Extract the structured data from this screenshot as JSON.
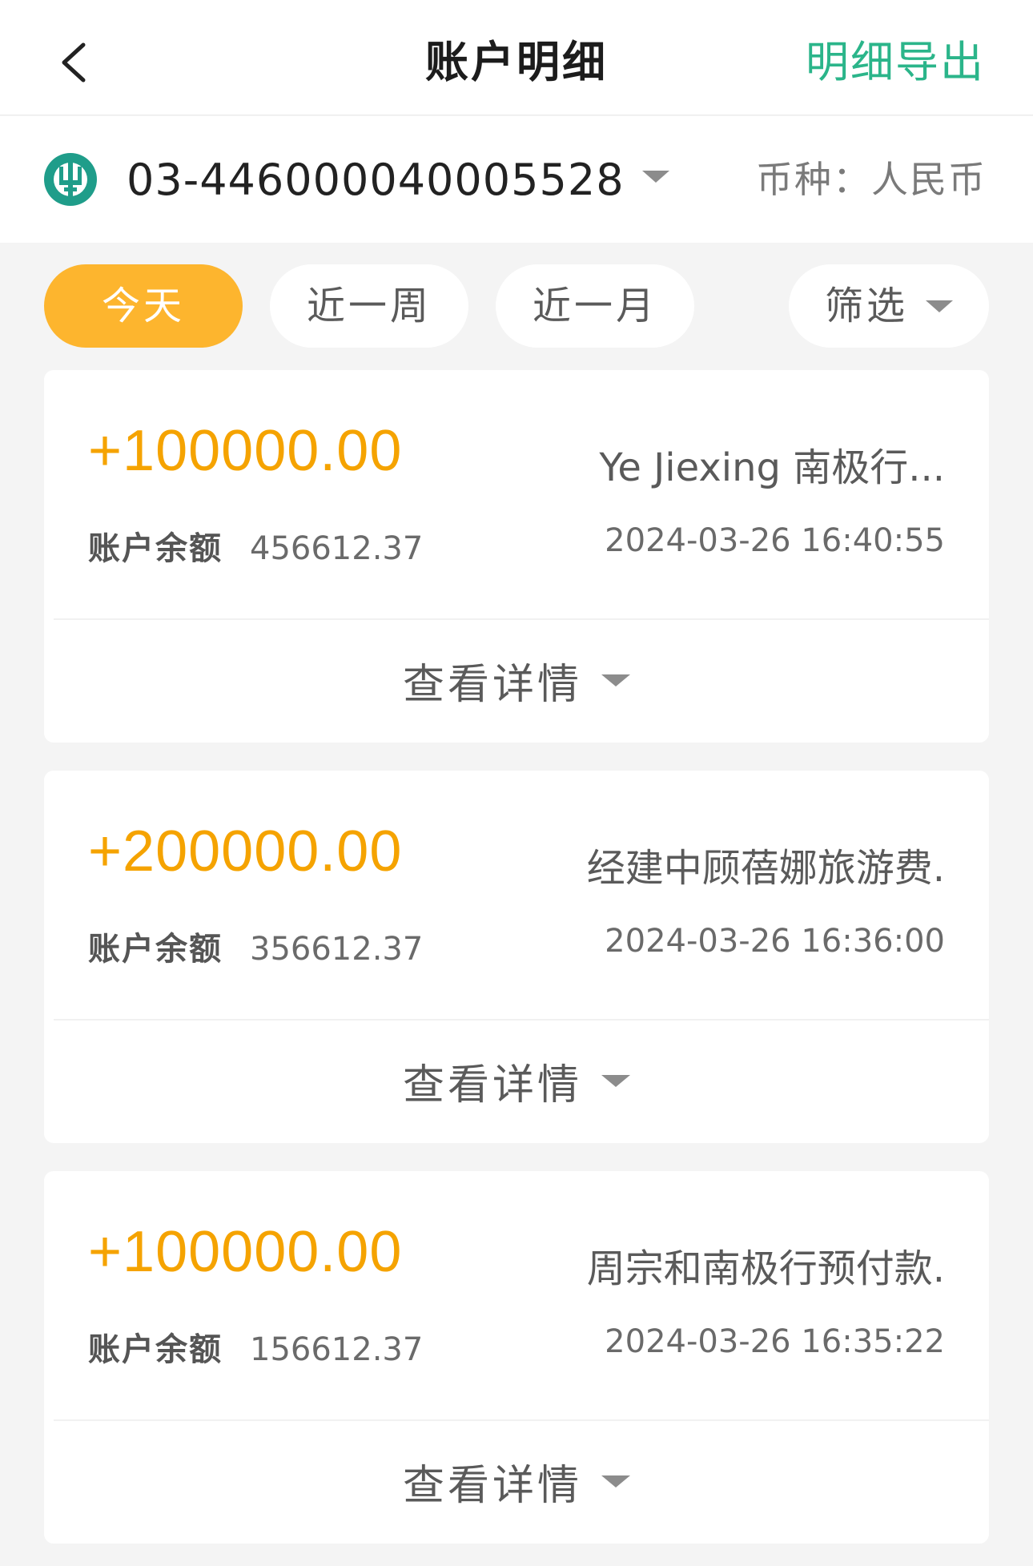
{
  "header": {
    "title": "账户明细",
    "export_label": "明细导出"
  },
  "account": {
    "number": "03-446000040005528",
    "currency": "币种：人民币"
  },
  "filters": {
    "today": "今天",
    "week": "近一周",
    "month": "近一月",
    "filter": "筛选",
    "active": "today"
  },
  "transactions": [
    {
      "amount": "+100000.00",
      "description": "Ye Jiexing 南极行...",
      "balance_label": "账户余额",
      "balance": "456612.37",
      "time": "2024-03-26 16:40:55",
      "detail_label": "查看详情"
    },
    {
      "amount": "+200000.00",
      "description": "经建中顾蓓娜旅游费.",
      "balance_label": "账户余额",
      "balance": "356612.37",
      "time": "2024-03-26 16:36:00",
      "detail_label": "查看详情"
    },
    {
      "amount": "+100000.00",
      "description": "周宗和南极行预付款.",
      "balance_label": "账户余额",
      "balance": "156612.37",
      "time": "2024-03-26 16:35:22",
      "detail_label": "查看详情"
    }
  ],
  "colors": {
    "accent_green": "#2bb58a",
    "amount_orange": "#f5a300",
    "chip_active": "#fdb52e",
    "logo_green": "#1f9d8a"
  }
}
